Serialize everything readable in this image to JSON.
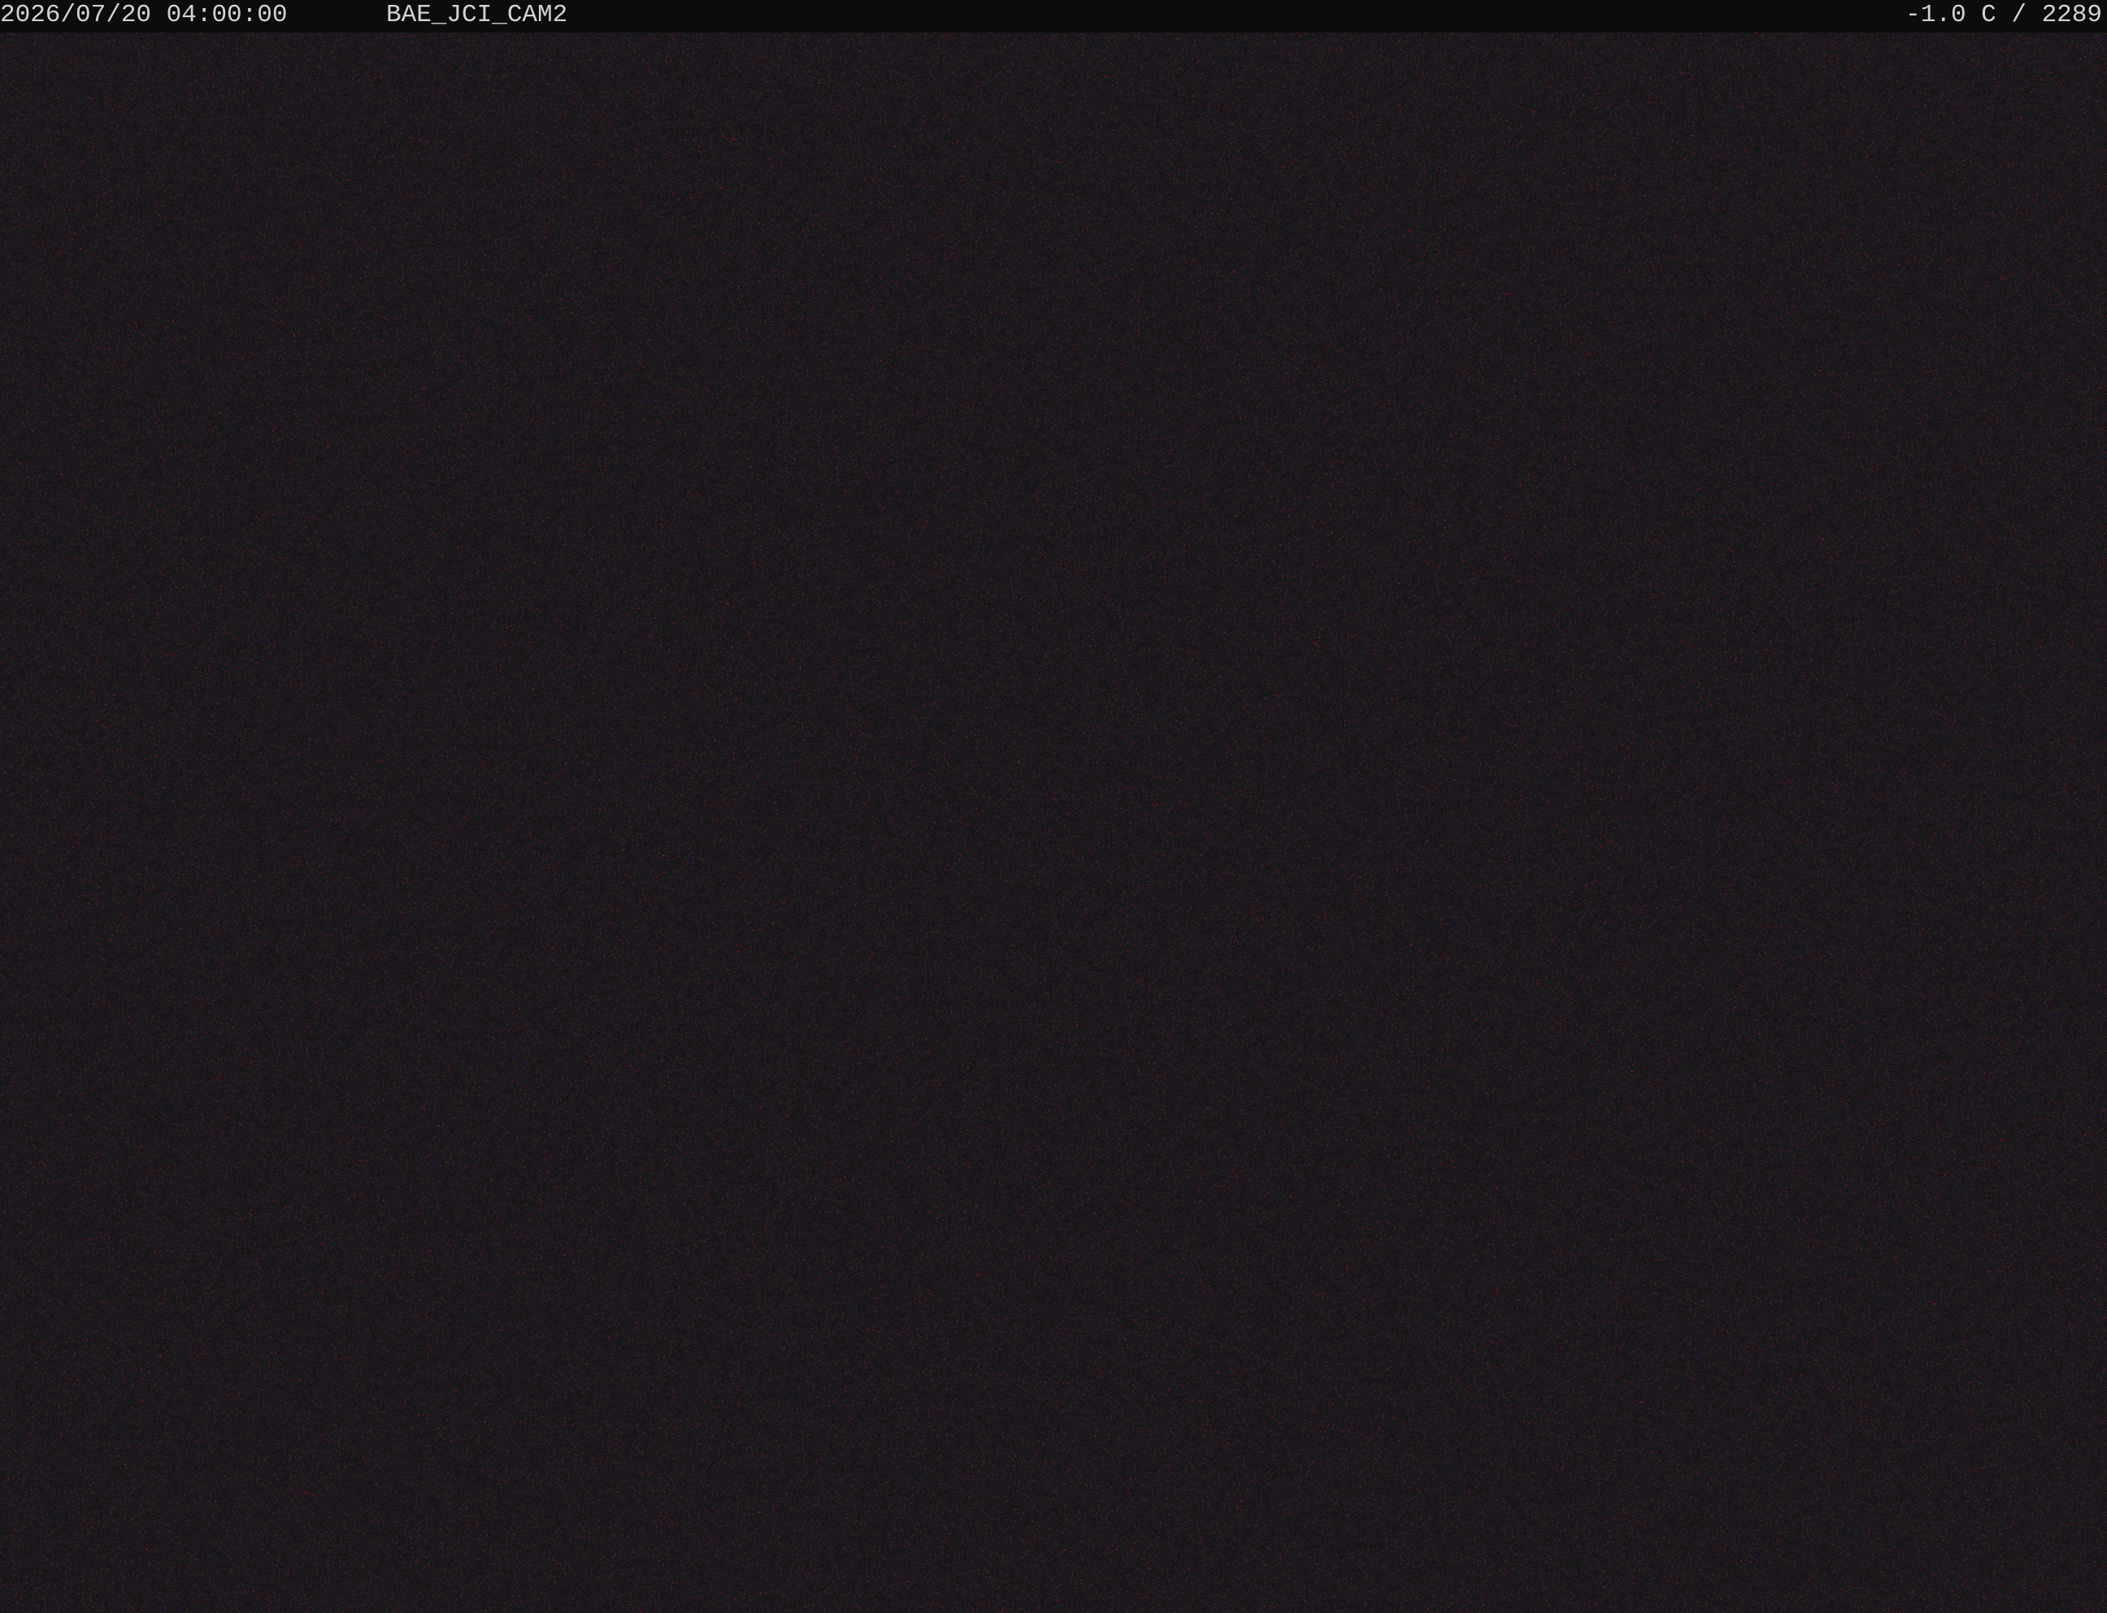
{
  "overlay": {
    "datetime": "2026/07/20  04:00:00",
    "camera_id": "BAE_JCI_CAM2",
    "reading": "-1.0 C / 2289"
  },
  "scene": {
    "description_colors": {
      "base": "#1c191c",
      "noise_red": "#7a2a2e",
      "noise_blue": "#2a2a4a",
      "osd_background": "#0c0c0c",
      "osd_text": "#d2d2d2"
    }
  }
}
